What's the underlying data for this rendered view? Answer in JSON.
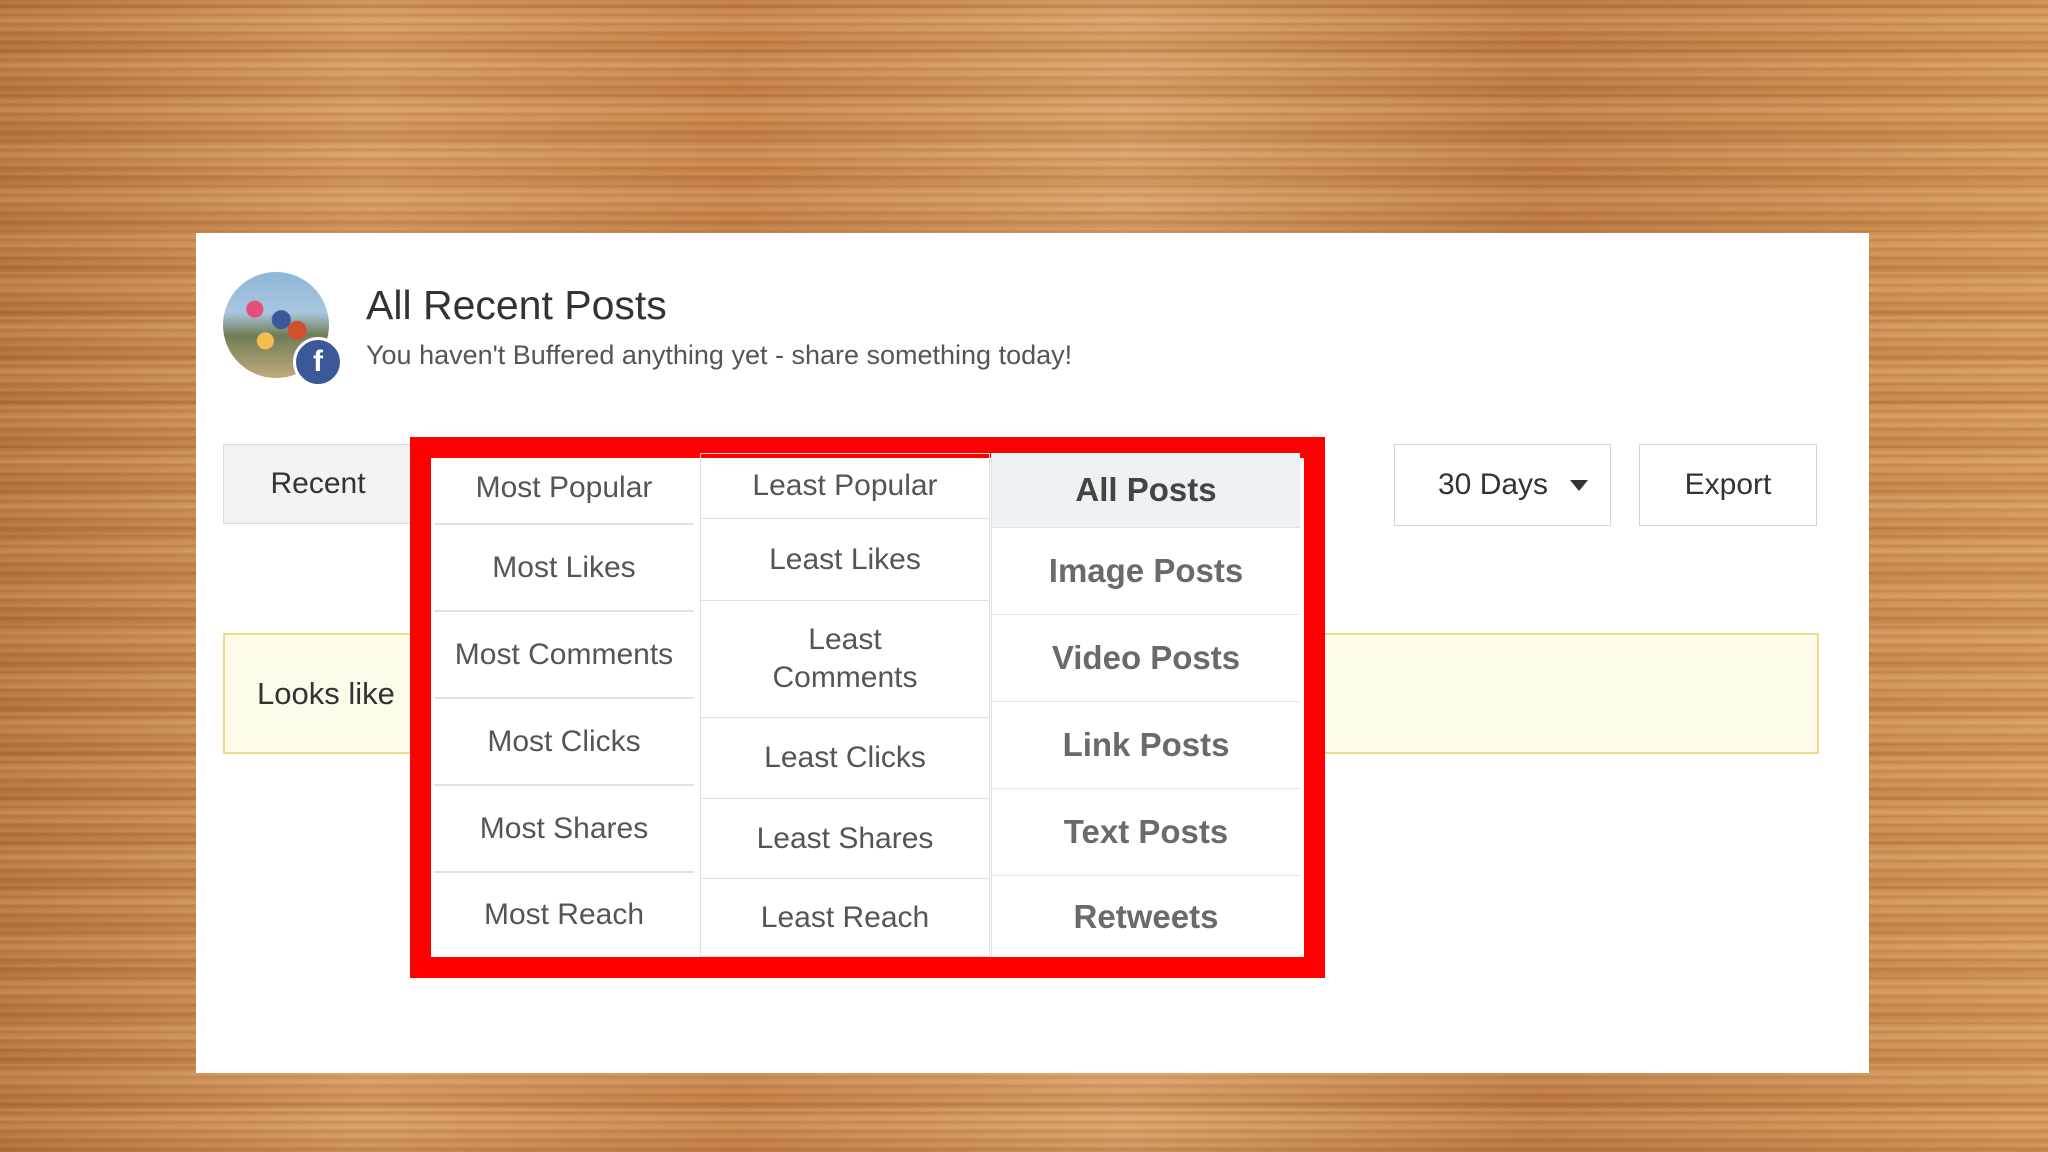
{
  "header": {
    "title": "All Recent Posts",
    "subtitle": "You haven't Buffered anything yet - share something today!",
    "badge_letter": "f",
    "avatar_icon": "profile-photo",
    "badge_icon": "facebook-icon"
  },
  "tabs": {
    "recent": "Recent"
  },
  "toolbar": {
    "range_label": "30 Days",
    "export_label": "Export"
  },
  "notice": {
    "text": "Looks like"
  },
  "dropdown": {
    "highlight_color": "#ff0000",
    "sort_most": [
      "Most Popular",
      "Most Likes",
      "Most Comments",
      "Most Clicks",
      "Most Shares",
      "Most Reach"
    ],
    "sort_least": [
      "Least Popular",
      "Least Likes",
      "Least Comments",
      "Least Clicks",
      "Least Shares",
      "Least Reach"
    ],
    "post_types": [
      "All Posts",
      "Image Posts",
      "Video Posts",
      "Link Posts",
      "Text Posts",
      "Retweets"
    ],
    "selected_post_type": "All Posts"
  }
}
